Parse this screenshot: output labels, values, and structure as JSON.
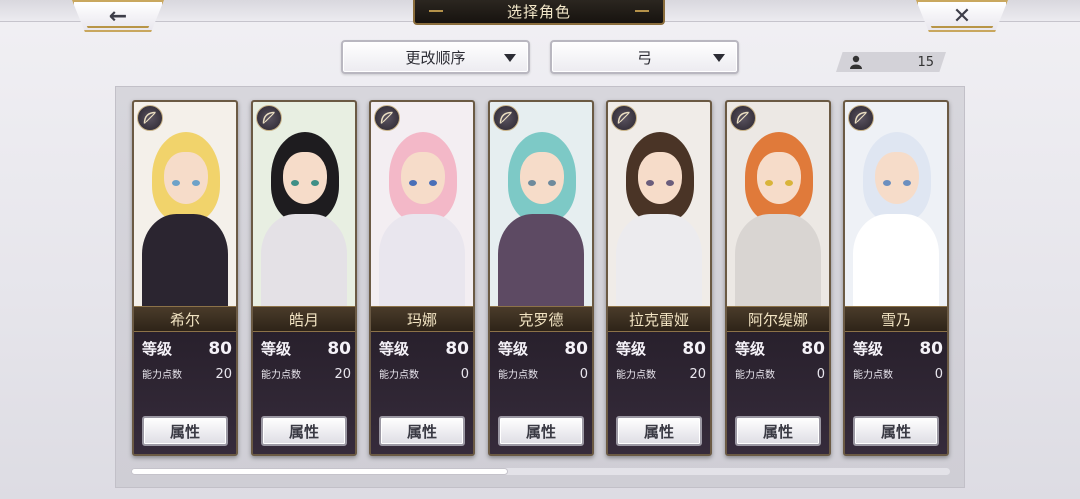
{
  "title": "选择角色",
  "nav": {
    "back_glyph": "←",
    "close_glyph": "✕",
    "back_icon": "back-arrow-icon",
    "close_icon": "close-icon"
  },
  "filters": {
    "order_label": "更改顺序",
    "weapon_label": "弓"
  },
  "roster_count": "15",
  "labels": {
    "level": "等级",
    "points": "能力点数",
    "attributes": "属性"
  },
  "characters": [
    {
      "name": "希尔",
      "level": "80",
      "points": "20"
    },
    {
      "name": "皓月",
      "level": "80",
      "points": "20"
    },
    {
      "name": "玛娜",
      "level": "80",
      "points": "0"
    },
    {
      "name": "克罗德",
      "level": "80",
      "points": "0"
    },
    {
      "name": "拉克雷娅",
      "level": "80",
      "points": "20"
    },
    {
      "name": "阿尔缇娜",
      "level": "80",
      "points": "0"
    },
    {
      "name": "雪乃",
      "level": "80",
      "points": "0"
    }
  ],
  "colors": {
    "accent_gold": "#c9a75e",
    "banner_dark": "#1e1a15",
    "card_dark": "#2b2430",
    "name_text": "#f1e3c2"
  },
  "scroll": {
    "position_fraction": 0.46
  }
}
